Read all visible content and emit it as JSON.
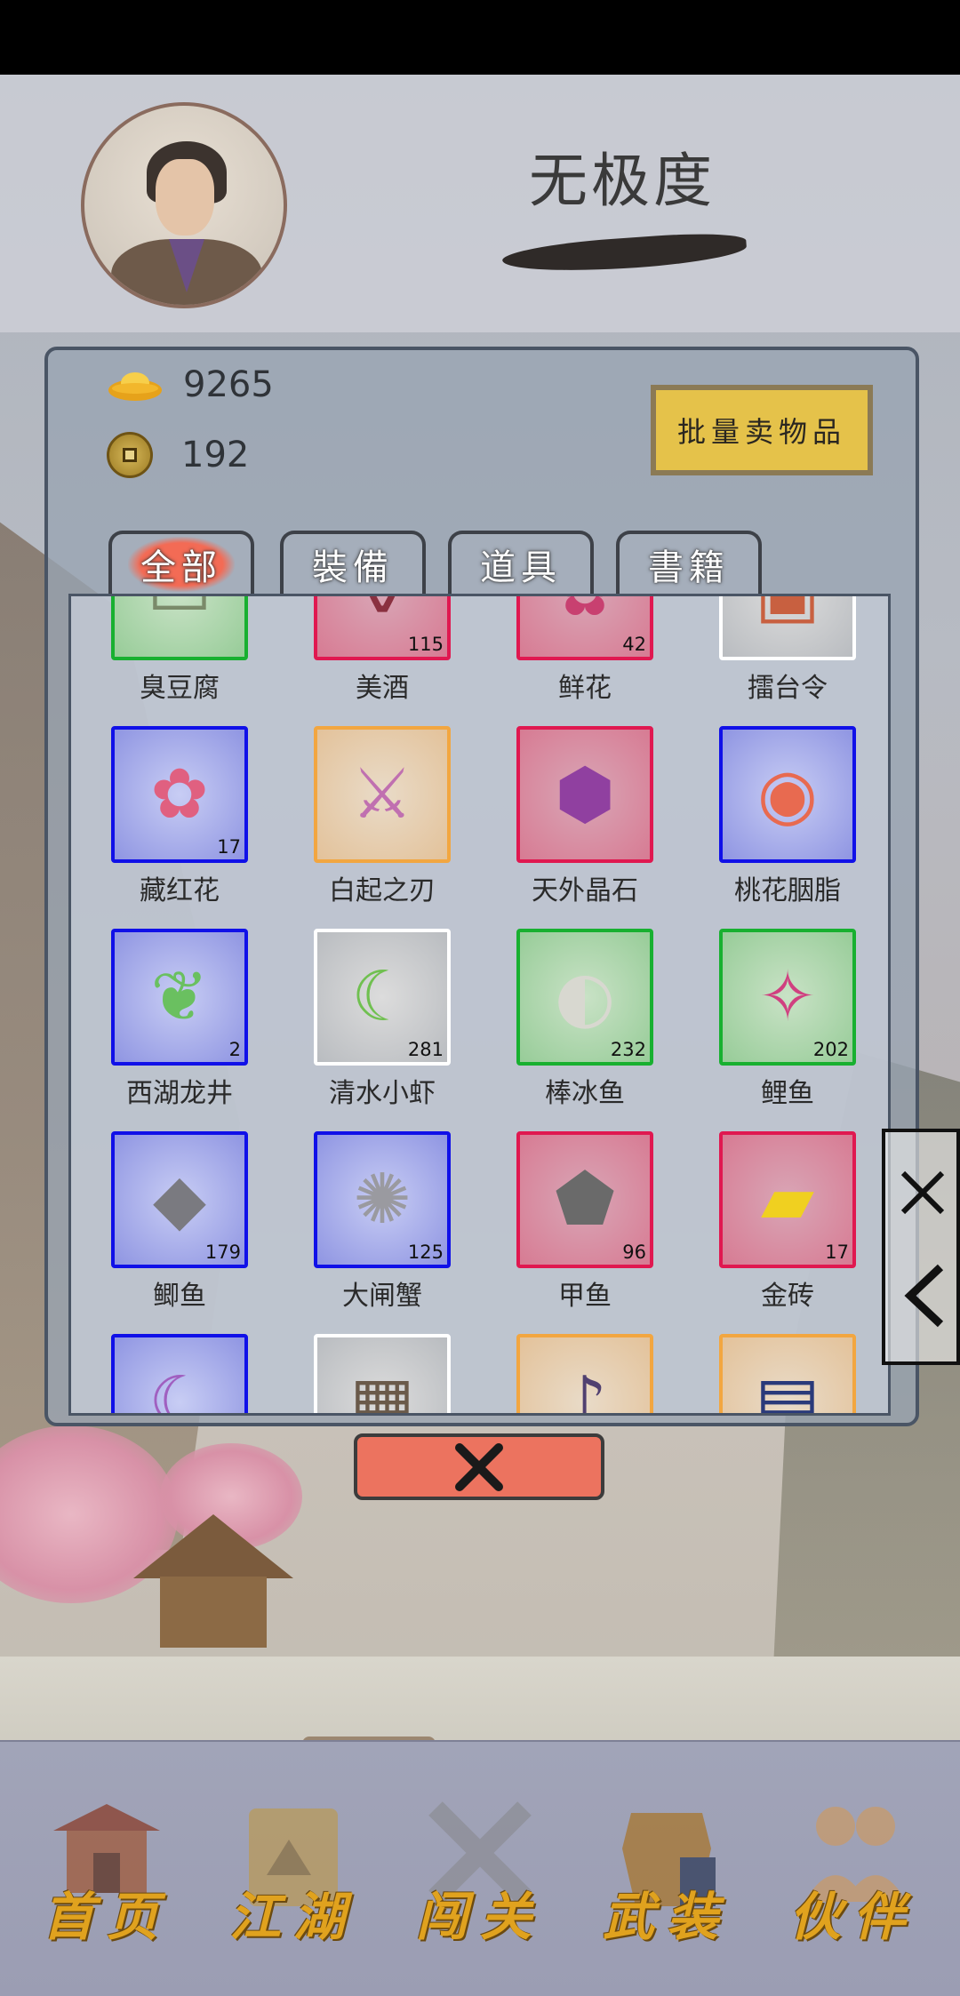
{
  "player": {
    "name": "无极度"
  },
  "currency": {
    "gold_ingots": "9265",
    "coins": "192"
  },
  "actions": {
    "bulk_sell": "批量卖物品"
  },
  "tabs": [
    {
      "label": "全部",
      "active": true
    },
    {
      "label": "裝備",
      "active": false
    },
    {
      "label": "道具",
      "active": false
    },
    {
      "label": "書籍",
      "active": false
    }
  ],
  "inventory": [
    {
      "name": "臭豆腐",
      "qty": "",
      "rarity": "green",
      "icon": "tofu-icon"
    },
    {
      "name": "美酒",
      "qty": "115",
      "rarity": "red",
      "icon": "wine-icon"
    },
    {
      "name": "鲜花",
      "qty": "42",
      "rarity": "red",
      "icon": "flower-icon"
    },
    {
      "name": "擂台令",
      "qty": "",
      "rarity": "white",
      "icon": "token-icon"
    },
    {
      "name": "藏红花",
      "qty": "17",
      "rarity": "blue",
      "icon": "saffron-icon"
    },
    {
      "name": "白起之刃",
      "qty": "",
      "rarity": "orange",
      "icon": "blade-icon"
    },
    {
      "name": "天外晶石",
      "qty": "",
      "rarity": "red",
      "icon": "crystal-icon"
    },
    {
      "name": "桃花胭脂",
      "qty": "",
      "rarity": "blue",
      "icon": "rouge-icon"
    },
    {
      "name": "西湖龙井",
      "qty": "2",
      "rarity": "blue",
      "icon": "tea-icon"
    },
    {
      "name": "清水小虾",
      "qty": "281",
      "rarity": "white",
      "icon": "shrimp-icon"
    },
    {
      "name": "棒冰鱼",
      "qty": "232",
      "rarity": "green",
      "icon": "ice-fish-icon"
    },
    {
      "name": "鲤鱼",
      "qty": "202",
      "rarity": "green",
      "icon": "carp-icon"
    },
    {
      "name": "鲫鱼",
      "qty": "179",
      "rarity": "blue",
      "icon": "crucian-icon"
    },
    {
      "name": "大闸蟹",
      "qty": "125",
      "rarity": "blue",
      "icon": "crab-icon"
    },
    {
      "name": "甲鱼",
      "qty": "96",
      "rarity": "red",
      "icon": "turtle-icon"
    },
    {
      "name": "金砖",
      "qty": "17",
      "rarity": "red",
      "icon": "gold-brick-icon"
    },
    {
      "name": "",
      "qty": "",
      "rarity": "blue",
      "icon": "moon-icon"
    },
    {
      "name": "",
      "qty": "",
      "rarity": "white",
      "icon": "box-icon"
    },
    {
      "name": "",
      "qty": "",
      "rarity": "orange",
      "icon": "erhu-icon"
    },
    {
      "name": "",
      "qty": "",
      "rarity": "orange",
      "icon": "book-icon"
    }
  ],
  "colors": {
    "blue": "#1010e8",
    "orange": "#f2a640",
    "red": "#e01850",
    "green": "#18b030",
    "white": "#ffffff",
    "close": "#ec735f",
    "nav_gold": "#e0a21e"
  },
  "nav": [
    {
      "label": "首页",
      "icon": "pavilion-icon"
    },
    {
      "label": "江湖",
      "icon": "scroll-map-icon"
    },
    {
      "label": "闯关",
      "icon": "crossed-swords-icon"
    },
    {
      "label": "武装",
      "icon": "armor-icon"
    },
    {
      "label": "伙伴",
      "icon": "companions-icon"
    }
  ]
}
